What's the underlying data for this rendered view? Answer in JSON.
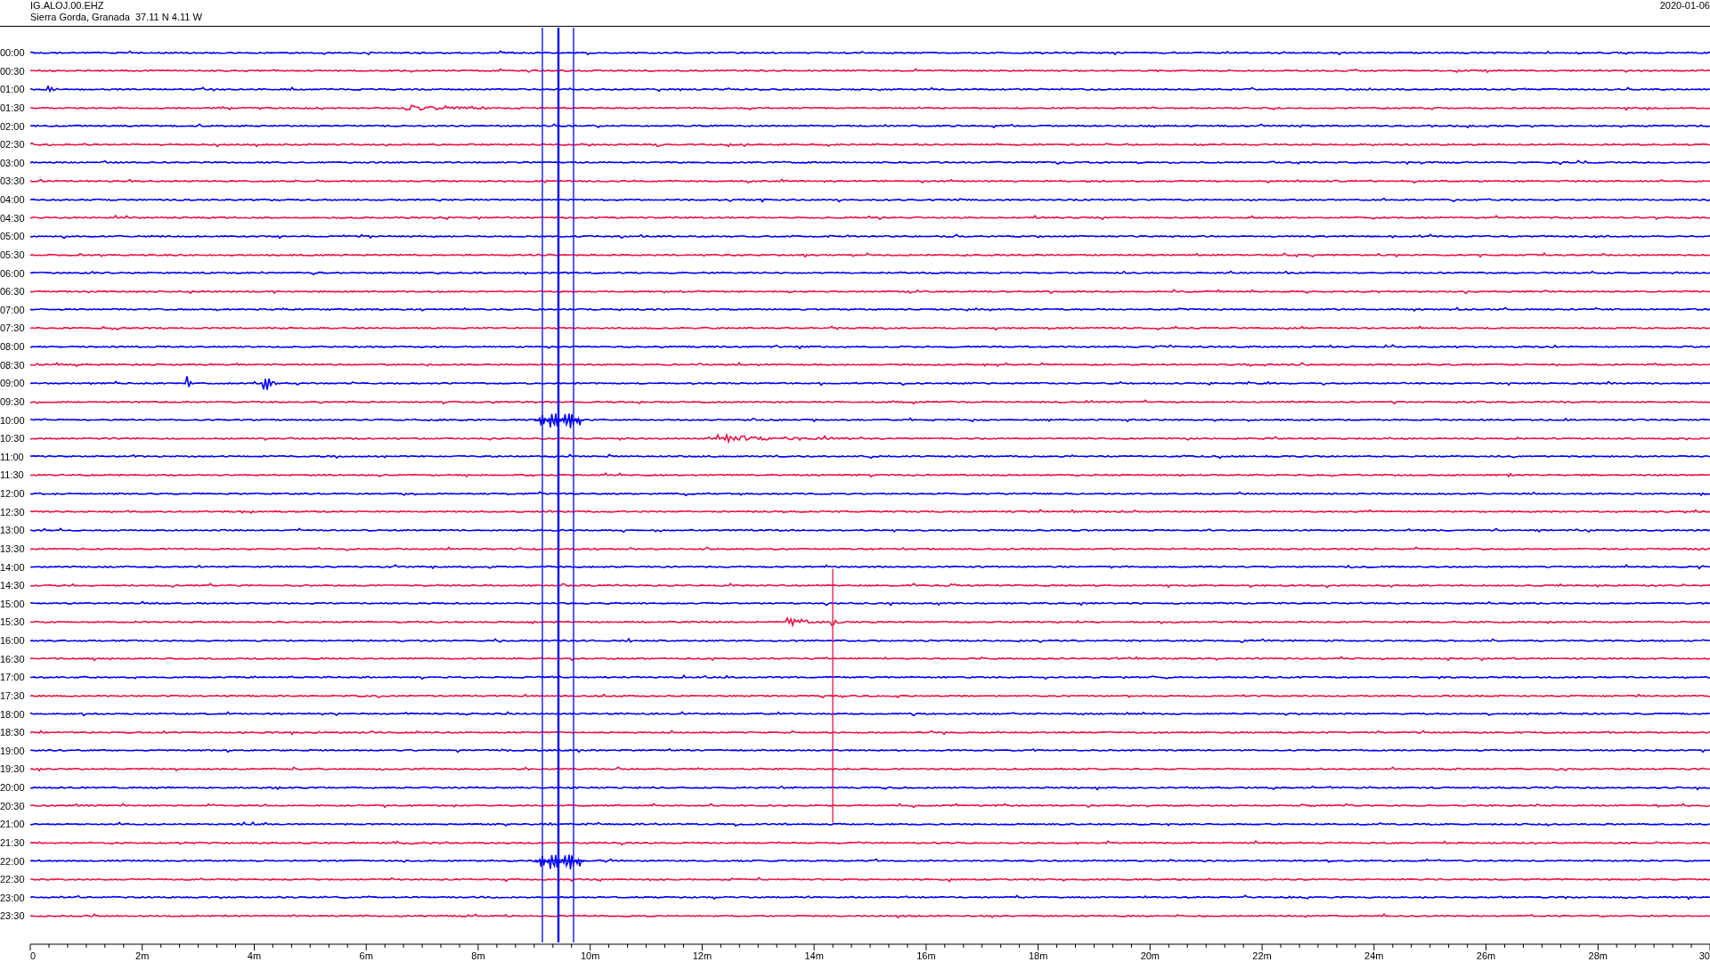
{
  "header": {
    "station": "IG.ALOJ.00.EHZ",
    "location": "Sierra Gorda, Granada  37.11 N 4.11 W",
    "date": "2020-01-06"
  },
  "rows": [
    {
      "time": "00:00",
      "color": "#0000ff"
    },
    {
      "time": "00:30",
      "color": "#ee1144"
    },
    {
      "time": "01:00",
      "color": "#0000ff"
    },
    {
      "time": "01:30",
      "color": "#ee1144"
    },
    {
      "time": "02:00",
      "color": "#0000ff"
    },
    {
      "time": "02:30",
      "color": "#ee1144"
    },
    {
      "time": "03:00",
      "color": "#0000ff"
    },
    {
      "time": "03:30",
      "color": "#ee1144"
    },
    {
      "time": "04:00",
      "color": "#0000ff"
    },
    {
      "time": "04:30",
      "color": "#ee1144"
    },
    {
      "time": "05:00",
      "color": "#0000ff"
    },
    {
      "time": "05:30",
      "color": "#ee1144"
    },
    {
      "time": "06:00",
      "color": "#0000ff"
    },
    {
      "time": "06:30",
      "color": "#ee1144"
    },
    {
      "time": "07:00",
      "color": "#0000ff"
    },
    {
      "time": "07:30",
      "color": "#ee1144"
    },
    {
      "time": "08:00",
      "color": "#0000ff"
    },
    {
      "time": "08:30",
      "color": "#ee1144"
    },
    {
      "time": "09:00",
      "color": "#0000ff"
    },
    {
      "time": "09:30",
      "color": "#ee1144"
    },
    {
      "time": "10:00",
      "color": "#0000ff"
    },
    {
      "time": "10:30",
      "color": "#ee1144"
    },
    {
      "time": "11:00",
      "color": "#0000ff"
    },
    {
      "time": "11:30",
      "color": "#ee1144"
    },
    {
      "time": "12:00",
      "color": "#0000ff"
    },
    {
      "time": "12:30",
      "color": "#ee1144"
    },
    {
      "time": "13:00",
      "color": "#0000ff"
    },
    {
      "time": "13:30",
      "color": "#ee1144"
    },
    {
      "time": "14:00",
      "color": "#0000ff"
    },
    {
      "time": "14:30",
      "color": "#ee1144"
    },
    {
      "time": "15:00",
      "color": "#0000ff"
    },
    {
      "time": "15:30",
      "color": "#ee1144"
    },
    {
      "time": "16:00",
      "color": "#0000ff"
    },
    {
      "time": "16:30",
      "color": "#ee1144"
    },
    {
      "time": "17:00",
      "color": "#0000ff"
    },
    {
      "time": "17:30",
      "color": "#ee1144"
    },
    {
      "time": "18:00",
      "color": "#0000ff"
    },
    {
      "time": "18:30",
      "color": "#ee1144"
    },
    {
      "time": "19:00",
      "color": "#0000ff"
    },
    {
      "time": "19:30",
      "color": "#ee1144"
    },
    {
      "time": "20:00",
      "color": "#0000ff"
    },
    {
      "time": "20:30",
      "color": "#ee1144"
    },
    {
      "time": "21:00",
      "color": "#0000ff"
    },
    {
      "time": "21:30",
      "color": "#ee1144"
    },
    {
      "time": "22:00",
      "color": "#0000ff"
    },
    {
      "time": "22:30",
      "color": "#ee1144"
    },
    {
      "time": "23:00",
      "color": "#0000ff"
    },
    {
      "time": "23:30",
      "color": "#ee1144"
    }
  ],
  "axis": {
    "tick_labels": [
      "0",
      "2m",
      "4m",
      "6m",
      "8m",
      "10m",
      "12m",
      "14m",
      "16m",
      "18m",
      "20m",
      "22m",
      "24m",
      "26m",
      "28m",
      "30"
    ]
  }
}
